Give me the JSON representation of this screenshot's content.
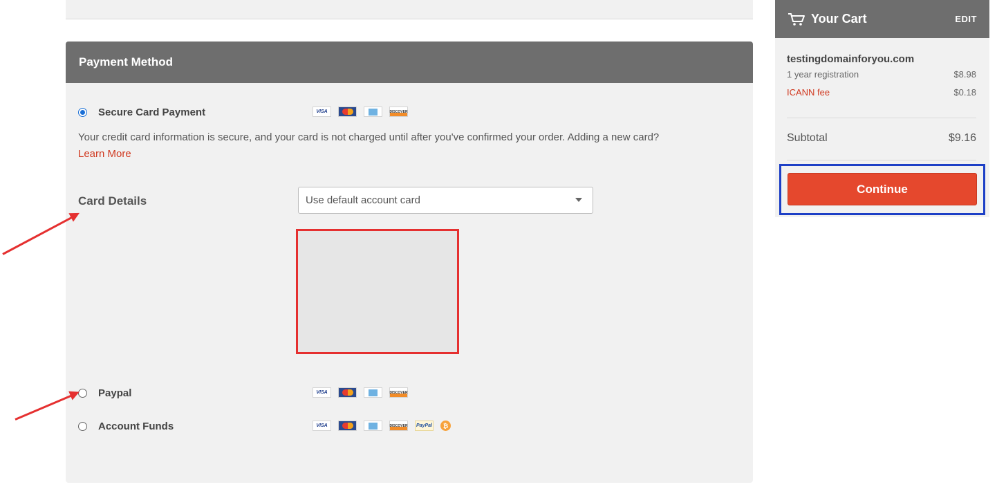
{
  "payment": {
    "header": "Payment Method",
    "options": [
      {
        "label": "Secure Card Payment",
        "selected": true,
        "cards": [
          "visa",
          "mastercard",
          "amex",
          "discover"
        ]
      },
      {
        "label": "Paypal",
        "selected": false,
        "cards": [
          "visa",
          "mastercard",
          "amex",
          "discover"
        ]
      },
      {
        "label": "Account Funds",
        "selected": false,
        "cards": [
          "visa",
          "mastercard",
          "amex",
          "discover",
          "paypal",
          "bitcoin"
        ]
      }
    ],
    "info_text": "Your credit card information is secure, and your card is not charged until after you've confirmed your order. Adding a new card?",
    "learn_more": "Learn More",
    "card_details_label": "Card Details",
    "card_select_value": "Use default account card",
    "card_labels": {
      "visa": "VISA",
      "discover": "DISCOVER",
      "paypal": "PayPal",
      "bitcoin": "₿"
    }
  },
  "cart": {
    "title": "Your Cart",
    "edit": "EDIT",
    "domain": "testingdomainforyou.com",
    "items": [
      {
        "label": "1 year registration",
        "amount": "$8.98"
      },
      {
        "label": "ICANN fee",
        "amount": "$0.18"
      }
    ],
    "subtotal_label": "Subtotal",
    "subtotal_amount": "$9.16",
    "continue_label": "Continue"
  },
  "colors": {
    "header_bg": "#6e6e6e",
    "panel_bg": "#f1f1f1",
    "accent": "#e5482d",
    "annotation_red": "#e53030",
    "annotation_blue": "#1d3fc6",
    "radio_selected": "#1a6fd6"
  }
}
